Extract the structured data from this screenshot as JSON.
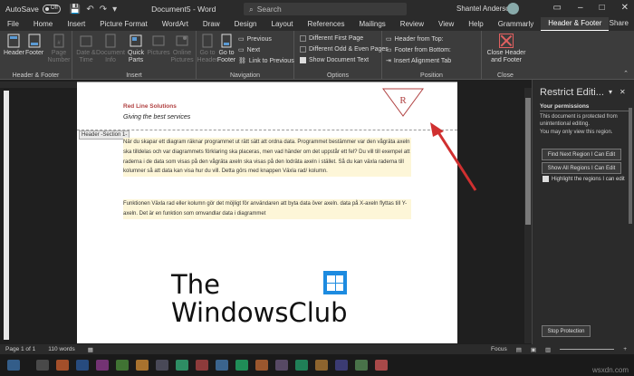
{
  "titlebar": {
    "autosave_label": "AutoSave",
    "autosave_state": "Off",
    "document_title": "Document5 - Word",
    "search_placeholder": "Search",
    "user_name": "Shantel Anderson",
    "share_label": "Share"
  },
  "tabs": [
    {
      "label": "File"
    },
    {
      "label": "Home"
    },
    {
      "label": "Insert"
    },
    {
      "label": "Picture Format"
    },
    {
      "label": "WordArt"
    },
    {
      "label": "Draw"
    },
    {
      "label": "Design"
    },
    {
      "label": "Layout"
    },
    {
      "label": "References"
    },
    {
      "label": "Mailings"
    },
    {
      "label": "Review"
    },
    {
      "label": "View"
    },
    {
      "label": "Help"
    },
    {
      "label": "Grammarly"
    },
    {
      "label": "Header & Footer",
      "active": true
    }
  ],
  "ribbon": {
    "group_hf": {
      "label": "Header & Footer",
      "header": "Header",
      "footer": "Footer",
      "page_number": "Page Number"
    },
    "group_insert": {
      "label": "Insert",
      "date_time": "Date & Time",
      "doc_info": "Document Info",
      "quick_parts": "Quick Parts",
      "pictures": "Pictures",
      "online_pictures": "Online Pictures"
    },
    "group_nav": {
      "label": "Navigation",
      "goto_header": "Go to Header",
      "goto_footer": "Go to Footer",
      "previous": "Previous",
      "next": "Next",
      "link_prev": "Link to Previous"
    },
    "group_options": {
      "label": "Options",
      "diff_first": "Different First Page",
      "diff_odd": "Different Odd & Even Pages",
      "show_doc": "Show Document Text"
    },
    "group_position": {
      "label": "Position",
      "header_top": "Header from Top:",
      "footer_bottom": "Footer from Bottom:",
      "insert_tab": "Insert Alignment Tab"
    },
    "group_close": {
      "label": "Close",
      "close_btn": "Close Header and Footer"
    }
  },
  "document": {
    "company": "Red Line Solutions",
    "tagline": "Giving the best services",
    "header_tag": "Header -Section 1-",
    "watermark_letter": "R",
    "para1": "När du  skapar ett diagram räknar programmet ut rätt sätt att ordna data. Programmet bestämmer var den vågräta axeln ska tilldelas och var diagrammets förklaring ska placeras, men vad händer om det uppstår ett fel? Du vill till exempel att raderna i de data som visas på den vågräta axeln ska visas på den lodräta axeln i stället. Så du kan växla raderna till kolumner så att data kan visa hur du vill. Detta görs med knappen Växla rad/ kolumn.",
    "para2": "Funktionen Växla rad eller kolumn gör det möjligt för användaren att byta data över axeln. data på X-axeln flyttas till Y-axeln. Det är en funktion som omvandlar data i diagrammet",
    "logo_line1": "The",
    "logo_line2": "WindowsClub"
  },
  "pane": {
    "title": "Restrict Editi...",
    "permissions_heading": "Your permissions",
    "protected_text": "This document is protected from unintentional editing.",
    "region_text": "You may only view this region.",
    "find_next": "Find Next Region I Can Edit",
    "show_all": "Show All Regions I Can Edit",
    "highlight": "Highlight the regions I can edit",
    "stop": "Stop Protection"
  },
  "status": {
    "page": "Page 1 of 1",
    "words": "110 words",
    "focus": "Focus",
    "zoom": "+"
  },
  "credit": "wsxdn.com",
  "colors": {
    "accent_red": "#b04040",
    "arrow_red": "#d03030"
  }
}
